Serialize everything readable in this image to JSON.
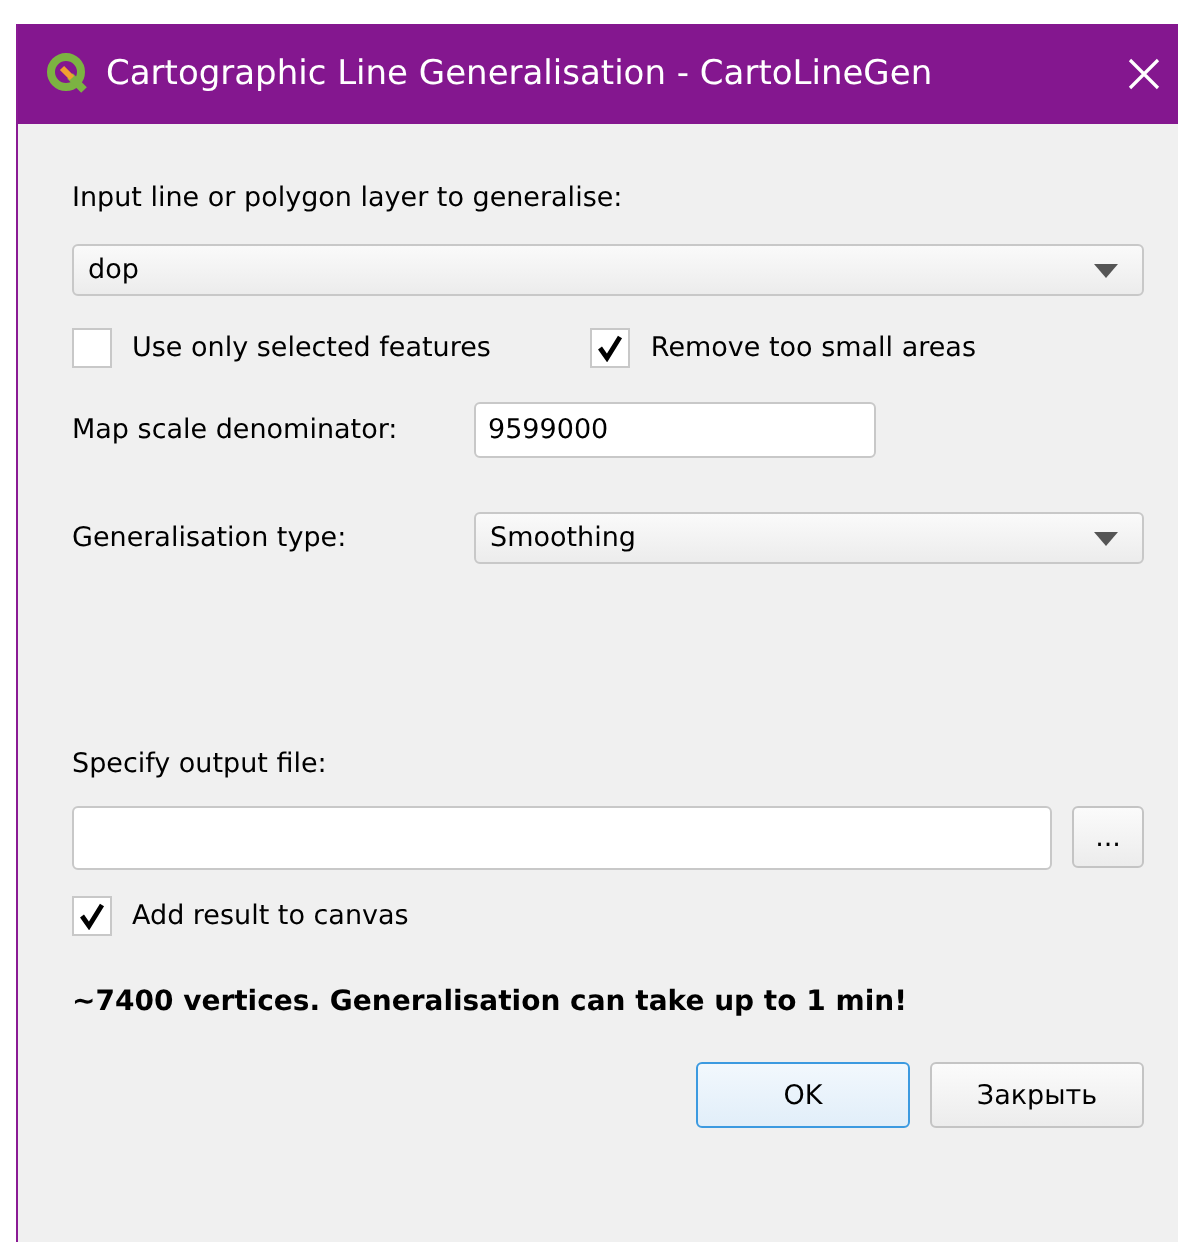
{
  "window": {
    "title": "Cartographic Line Generalisation - CartoLineGen"
  },
  "input_layer": {
    "label": "Input line or polygon layer to generalise:",
    "value": "dop"
  },
  "options": [
    {
      "label": "Use only selected features",
      "checked": false
    },
    {
      "label": "Remove too small areas",
      "checked": true
    }
  ],
  "scale": {
    "label": "Map scale denominator:",
    "value": "9599000"
  },
  "generalisation_type": {
    "label": "Generalisation type:",
    "value": "Smoothing"
  },
  "output": {
    "label": "Specify output file:",
    "browse": "..."
  },
  "add_to_canvas": {
    "label": "Add result to canvas",
    "checked": true
  },
  "message": "~7400 vertices. Generalisation can take up to 1 min!",
  "buttons": [
    {
      "label": "OK",
      "selected": true
    },
    {
      "label": "Закрыть",
      "selected": false
    }
  ]
}
